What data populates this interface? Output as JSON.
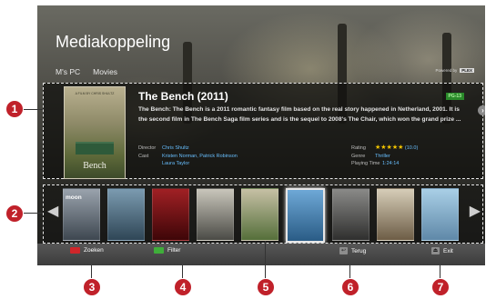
{
  "app": {
    "title": "Mediakoppeling"
  },
  "breadcrumb": [
    "M's PC",
    "Movies"
  ],
  "powered_by": {
    "text": "Powered by",
    "logo": "PLEX"
  },
  "movie": {
    "poster_top_text": "A FILM BY CHRIS SHULTZ",
    "poster_title": "Bench",
    "title": "The Bench (2011)",
    "parental_rating": "PG-13",
    "description": "The Bench: The Bench is a 2011 romantic fantasy film based on the real story happened in Netherland, 2001. It is the second film in The Bench Saga film series and is the sequel to 2008's The Chair, which won the grand prize ...",
    "director_label": "Director",
    "director": "Chris Shultz",
    "cast_label": "Cast",
    "cast_line1": "Kristen Norman, Patrick Robinson",
    "cast_line2": "Laura Taylor",
    "rating_label": "Rating",
    "stars": "★★★★★",
    "rating_value": "(10.0)",
    "genre_label": "Genre",
    "genre": "Thriller",
    "playing_time_label": "Playing Time",
    "playing_time": "1:24:14"
  },
  "thumbnails": [
    {
      "text": "moon",
      "color1": "#9aa3ad",
      "color2": "#3e4750"
    },
    {
      "text": "",
      "color1": "#7b9bb0",
      "color2": "#2f4656"
    },
    {
      "text": "",
      "color1": "#a02024",
      "color2": "#3e0608"
    },
    {
      "text": "",
      "color1": "#c9c6bb",
      "color2": "#4b4b46"
    },
    {
      "text": "",
      "color1": "#c6c0a5",
      "color2": "#556f3a"
    },
    {
      "text": "",
      "color1": "#6ea8d6",
      "color2": "#2a5c86"
    },
    {
      "text": "",
      "color1": "#8a8a88",
      "color2": "#2f2f2e"
    },
    {
      "text": "",
      "color1": "#d6cdb8",
      "color2": "#6d5d46"
    },
    {
      "text": "",
      "color1": "#a9cfe6",
      "color2": "#5f88a8"
    }
  ],
  "bottom_bar": {
    "search": "Zoeken",
    "filter": "Filter",
    "back": "Terug",
    "exit": "Exit"
  },
  "callouts": [
    "1",
    "2",
    "3",
    "4",
    "5",
    "6",
    "7"
  ],
  "colors": {
    "callout": "#c0212a",
    "link": "#68bfff",
    "star": "#f3c400"
  }
}
